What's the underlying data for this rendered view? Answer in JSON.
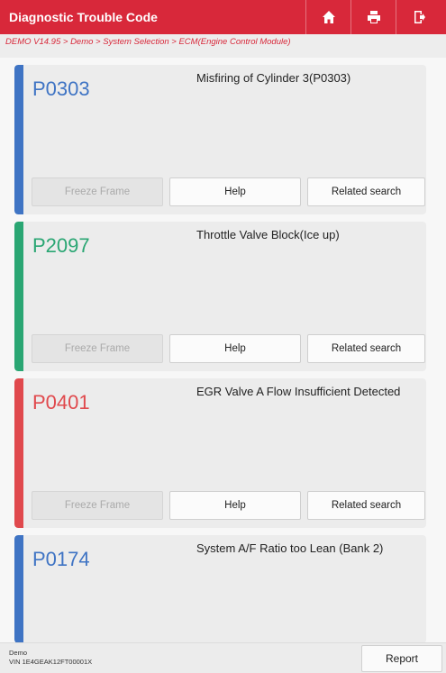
{
  "header": {
    "title": "Diagnostic Trouble Code",
    "icons": [
      "home-icon",
      "print-icon",
      "exit-icon"
    ],
    "color": "#d8283a"
  },
  "breadcrumb": "DEMO V14.95 > Demo > System Selection > ECM(Engine Control Module)",
  "codes": [
    {
      "code": "P0303",
      "description": "Misfiring of Cylinder 3(P0303)",
      "color": "#3f74c4",
      "buttons": {
        "freeze": "Freeze Frame",
        "help": "Help",
        "related": "Related search"
      }
    },
    {
      "code": "P2097",
      "description": "Throttle Valve Block(Ice up)",
      "color": "#2aa673",
      "buttons": {
        "freeze": "Freeze Frame",
        "help": "Help",
        "related": "Related search"
      }
    },
    {
      "code": "P0401",
      "description": "EGR Valve A Flow Insufficient Detected",
      "color": "#e0494d",
      "buttons": {
        "freeze": "Freeze Frame",
        "help": "Help",
        "related": "Related search"
      }
    },
    {
      "code": "P0174",
      "description": "System A/F Ratio too Lean (Bank 2)",
      "color": "#3f74c4"
    }
  ],
  "footer": {
    "vehicle": "Demo",
    "vin": "VIN 1E4GEAK12FT00001X",
    "report_label": "Report"
  }
}
